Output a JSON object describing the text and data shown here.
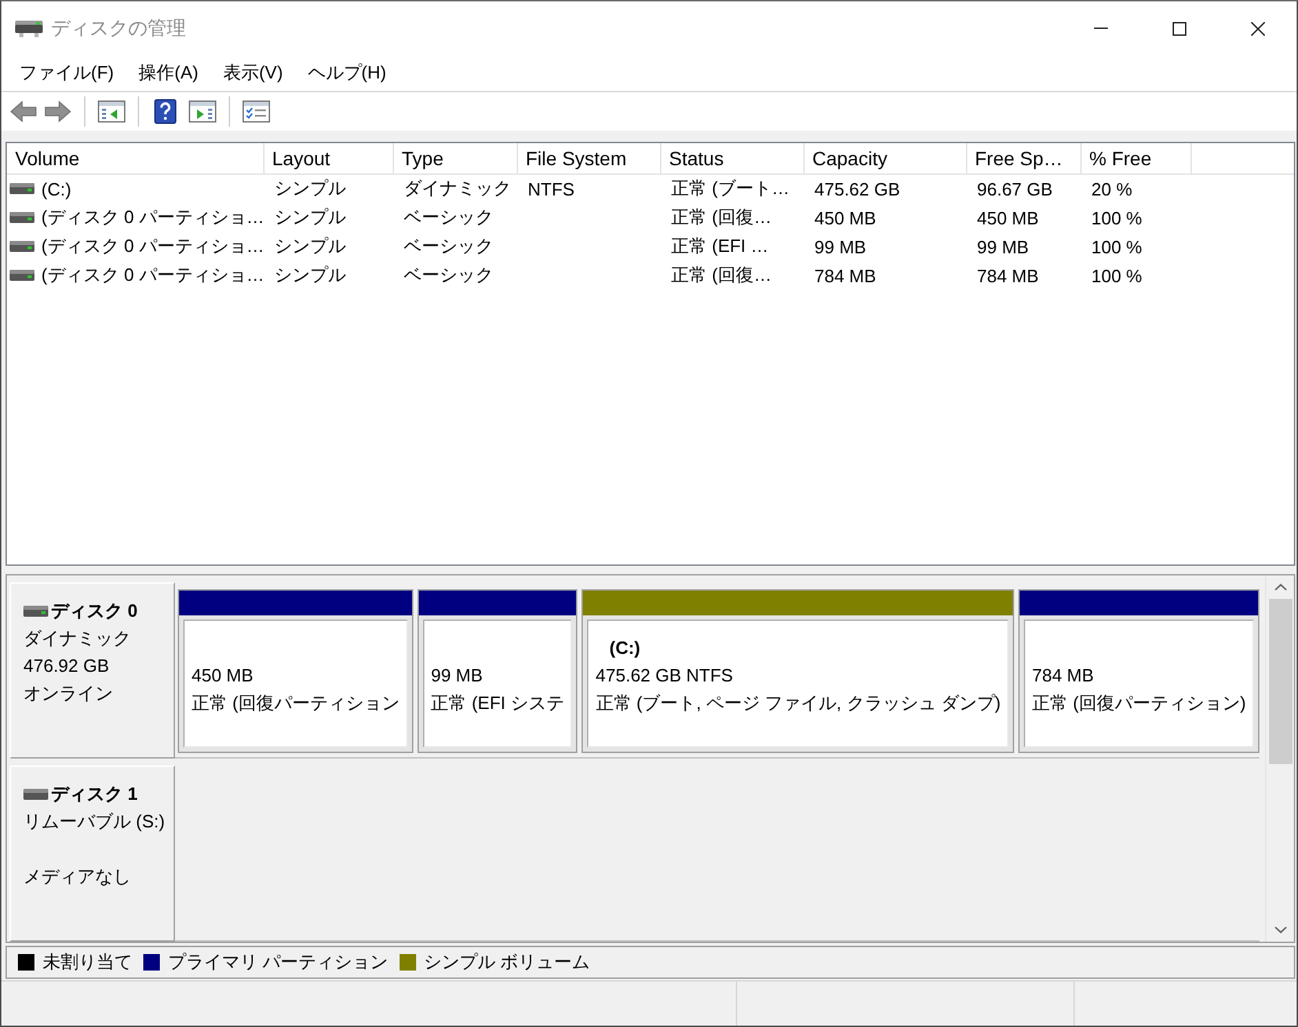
{
  "window": {
    "title": "ディスクの管理"
  },
  "menu": [
    "ファイル(F)",
    "操作(A)",
    "表示(V)",
    "ヘルプ(H)"
  ],
  "volume_table": {
    "columns": [
      "Volume",
      "Layout",
      "Type",
      "File System",
      "Status",
      "Capacity",
      "Free Sp…",
      "% Free"
    ],
    "rows": [
      {
        "volume": "(C:)",
        "layout": "シンプル",
        "type": "ダイナミック",
        "file_system": "NTFS",
        "status": "正常 (ブート…",
        "capacity": "475.62 GB",
        "free_space": "96.67 GB",
        "percent_free": "20 %"
      },
      {
        "volume": "(ディスク 0 パーティショ…",
        "layout": "シンプル",
        "type": "ベーシック",
        "status": "正常 (回復…",
        "capacity": "450 MB",
        "free_space": "450 MB",
        "percent_free": "100 %"
      },
      {
        "volume": "(ディスク 0 パーティショ…",
        "layout": "シンプル",
        "type": "ベーシック",
        "status": "正常 (EFI …",
        "capacity": "99 MB",
        "free_space": "99 MB",
        "percent_free": "100 %"
      },
      {
        "volume": "(ディスク 0 パーティショ…",
        "layout": "シンプル",
        "type": "ベーシック",
        "status": "正常 (回復…",
        "capacity": "784 MB",
        "free_space": "784 MB",
        "percent_free": "100 %"
      }
    ]
  },
  "disks": [
    {
      "name": "ディスク 0",
      "type": "ダイナミック",
      "size": "476.92 GB",
      "status": "オンライン",
      "partitions": [
        {
          "size": "450 MB",
          "status": "正常 (回復パーティション",
          "color": "#000080"
        },
        {
          "size": "99 MB",
          "status": "正常 (EFI システ",
          "color": "#000080"
        },
        {
          "name": "(C:)",
          "size": "475.62 GB NTFS",
          "status": "正常 (ブート, ページ ファイル, クラッシュ ダンプ)",
          "color": "#808000"
        },
        {
          "size": "784 MB",
          "status": "正常 (回復パーティション)",
          "color": "#000080"
        }
      ]
    },
    {
      "name": "ディスク 1",
      "type": "リムーバブル (S:)",
      "status": "メディアなし"
    }
  ],
  "legend": [
    {
      "label": "未割り当て",
      "color": "#000000"
    },
    {
      "label": "プライマリ パーティション",
      "color": "#000080"
    },
    {
      "label": "シンプル ボリューム",
      "color": "#808000"
    }
  ]
}
